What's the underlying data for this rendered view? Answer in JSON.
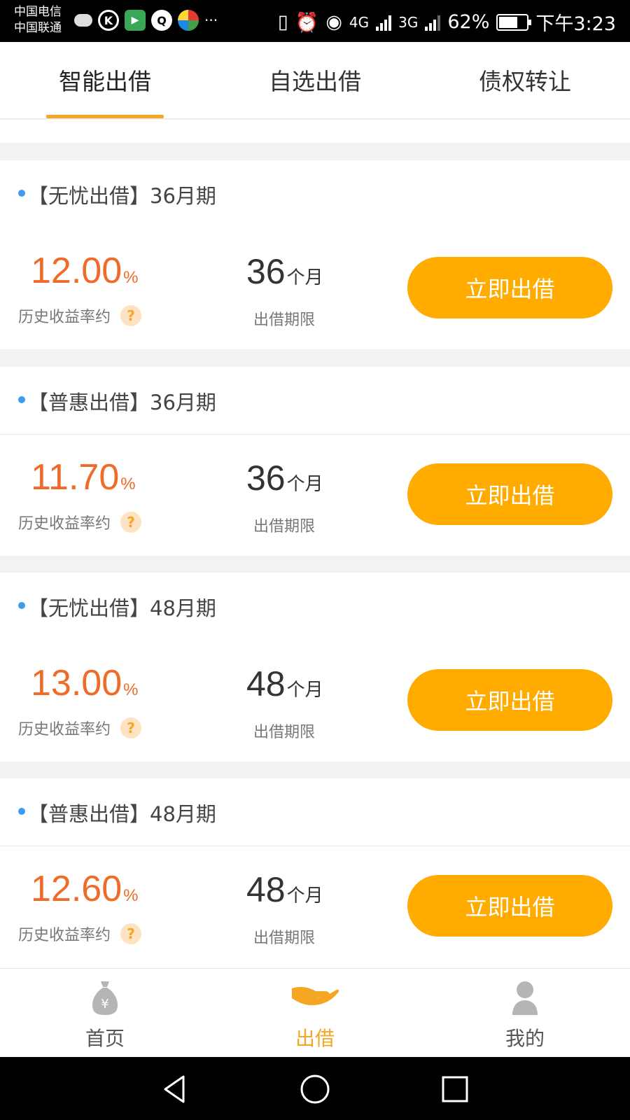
{
  "status_bar": {
    "carrier_1": "中国电信",
    "carrier_2": "中国联通",
    "battery": "62%",
    "time": "下午3:23",
    "net_1": "4G",
    "net_2": "3G",
    "more": "···"
  },
  "tabs": [
    {
      "label": "智能出借",
      "active": true
    },
    {
      "label": "自选出借",
      "active": false
    },
    {
      "label": "债权转让",
      "active": false
    }
  ],
  "products": [
    {
      "title": "【无忧出借】36月期",
      "rate": "12.00",
      "rate_unit": "%",
      "rate_label": "历史收益率约",
      "term": "36",
      "term_unit": "个月",
      "term_label": "出借期限",
      "button": "立即出借",
      "help_icon": "?"
    },
    {
      "title": "【普惠出借】36月期",
      "rate": "11.70",
      "rate_unit": "%",
      "rate_label": "历史收益率约",
      "term": "36",
      "term_unit": "个月",
      "term_label": "出借期限",
      "button": "立即出借",
      "help_icon": "?"
    },
    {
      "title": "【无忧出借】48月期",
      "rate": "13.00",
      "rate_unit": "%",
      "rate_label": "历史收益率约",
      "term": "48",
      "term_unit": "个月",
      "term_label": "出借期限",
      "button": "立即出借",
      "help_icon": "?"
    },
    {
      "title": "【普惠出借】48月期",
      "rate": "12.60",
      "rate_unit": "%",
      "rate_label": "历史收益率约",
      "term": "48",
      "term_unit": "个月",
      "term_label": "出借期限",
      "button": "立即出借",
      "help_icon": "?"
    }
  ],
  "bottom_nav": [
    {
      "label": "首页",
      "icon": "money-bag-icon",
      "active": false
    },
    {
      "label": "出借",
      "icon": "hand-icon",
      "active": true
    },
    {
      "label": "我的",
      "icon": "person-icon",
      "active": false
    }
  ],
  "colors": {
    "accent": "#f5a623",
    "button": "#ffab00",
    "rate": "#f06a28",
    "dot": "#3b9cf0"
  }
}
